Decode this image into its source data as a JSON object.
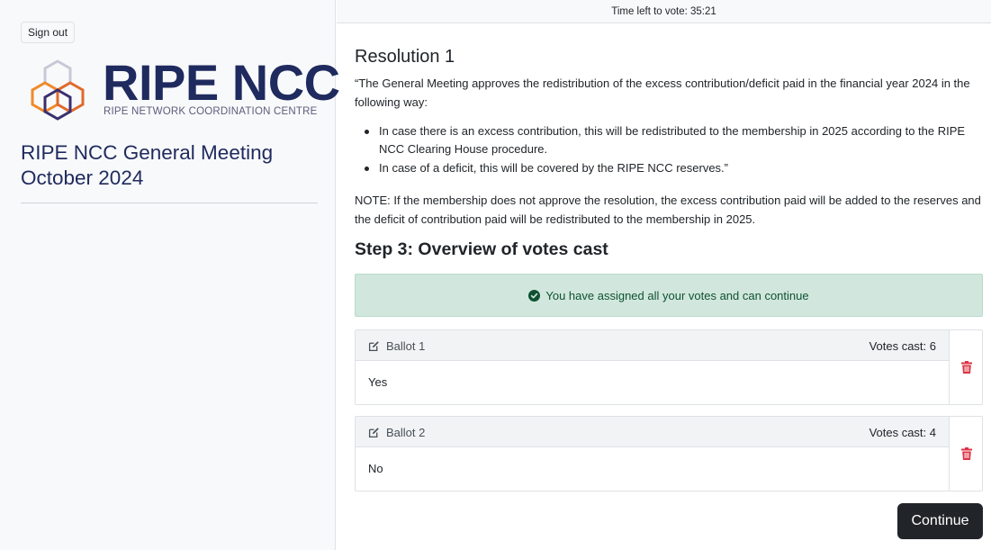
{
  "sidebar": {
    "signout_label": "Sign out",
    "logo": {
      "wordmark": "RIPE NCC",
      "subtitle": "RIPE NETWORK COORDINATION CENTRE"
    },
    "meeting_title": "RIPE NCC General Meeting October 2024"
  },
  "timer": {
    "text": "Time left to vote: 35:21"
  },
  "resolution": {
    "title": "Resolution 1",
    "intro": "“The General Meeting approves the redistribution of the excess contribution/deficit paid in the financial year 2024 in the following way:",
    "bullets": [
      "In case there is an excess contribution, this will be redistributed to the membership in 2025 according to the RIPE NCC Clearing House procedure.",
      "In case of a deficit, this will be covered by the RIPE NCC reserves.”"
    ],
    "note": "NOTE: If the membership does not approve the resolution, the excess contribution paid will be added to the reserves and the deficit of contribution paid will be redistributed to the membership in 2025."
  },
  "step": {
    "title": "Step 3: Overview of votes cast",
    "alert": "You have assigned all your votes and can continue"
  },
  "ballots": [
    {
      "name": "Ballot 1",
      "votes_cast": "Votes cast: 6",
      "choice": "Yes"
    },
    {
      "name": "Ballot 2",
      "votes_cast": "Votes cast: 4",
      "choice": "No"
    }
  ],
  "actions": {
    "continue_label": "Continue"
  },
  "colors": {
    "brand_navy": "#1f2a5e",
    "success_bg": "#d1e7dd",
    "success_text": "#0f5132",
    "danger": "#dc3545",
    "button_dark": "#212529"
  },
  "icons": {
    "logo": "ripe-hexagon-logo",
    "alert": "check-circle-icon",
    "ballot_edit": "edit-icon",
    "ballot_delete": "trash-icon"
  }
}
